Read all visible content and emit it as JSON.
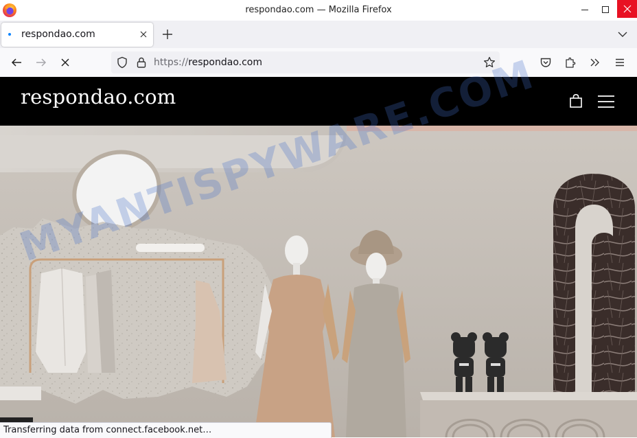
{
  "window": {
    "title": "respondao.com — Mozilla Firefox"
  },
  "tabs": [
    {
      "title": "respondao.com",
      "loading": true
    }
  ],
  "navbar": {
    "url_protocol": "https://",
    "url_host": "respondao.com"
  },
  "site": {
    "logo_text": "respondao.com"
  },
  "watermark": {
    "text": "MYANTISPYWARE.COM"
  },
  "status": {
    "text": "Transferring data from connect.facebook.net…"
  },
  "colors": {
    "close_button": "#e81123",
    "tab_loading_dot": "#0a84ff",
    "site_header_bg": "#000000",
    "watermark": "#466ec8"
  },
  "icons": {
    "app": "firefox-icon",
    "window_controls": [
      "minimize-icon",
      "maximize-icon",
      "close-icon"
    ],
    "nav": [
      "back-arrow-icon",
      "forward-arrow-icon",
      "stop-icon"
    ],
    "urlbar": [
      "shield-icon",
      "lock-icon",
      "star-icon"
    ],
    "toolbar": [
      "pocket-icon",
      "extensions-icon",
      "overflow-icon",
      "hamburger-menu-icon"
    ],
    "site": [
      "shopping-bag-icon",
      "site-menu-icon"
    ]
  }
}
